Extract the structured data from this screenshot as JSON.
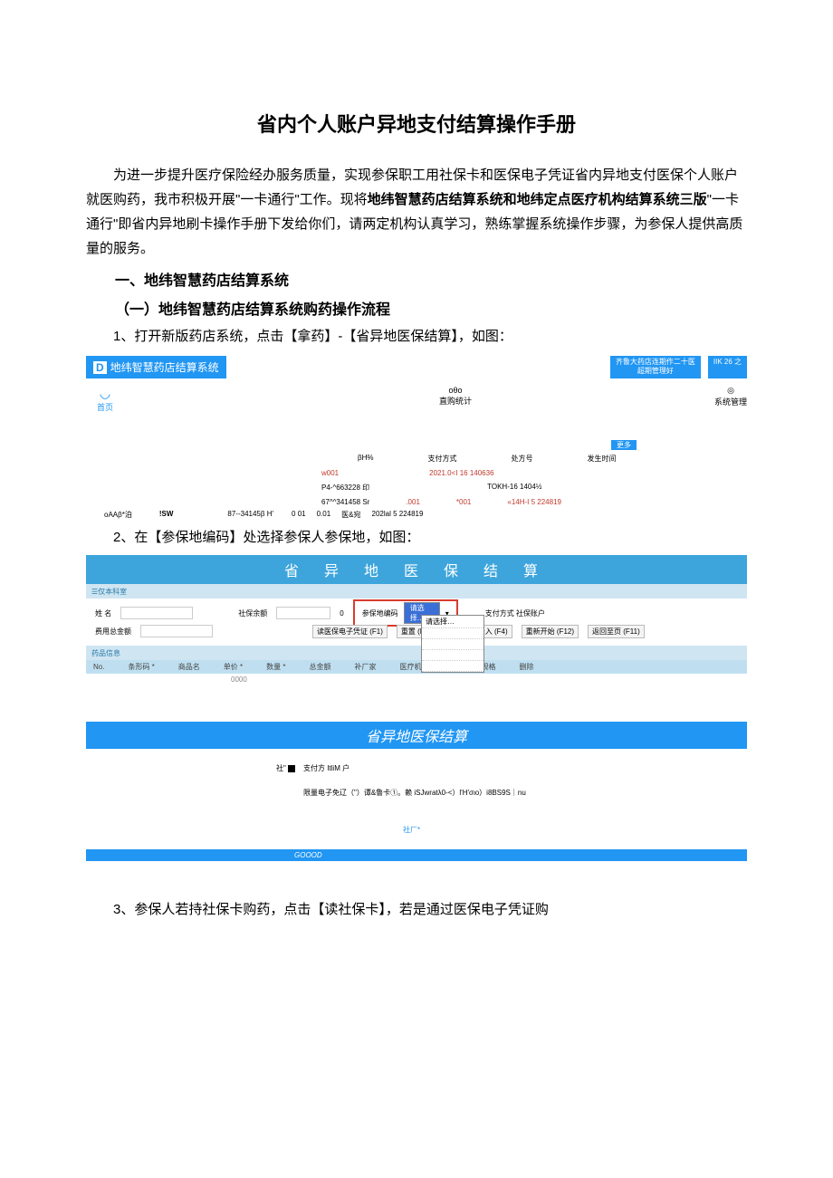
{
  "title": "省内个人账户异地支付结算操作手册",
  "para1_a": "为进一步提升医疗保险经办服务质量，实现参保职工用社保卡和医保电子凭证省内异地支付医保个人账户就医购药，我市积极开展\"一卡通行\"工作。现将",
  "para1_b": "地纬智慧药店结算系统和地纬定点医疗机构结算系统三版",
  "para1_c": "\"一卡通行\"即省内异地刷卡操作手册下发给你们，请两定机构认真学习，熟练掌握系统操作步骤，为参保人提供高质量的服务。",
  "sec1": "一、地纬智慧药店结算系统",
  "sub1": "（一）地纬智慧药店结算系统购药操作流程",
  "step1": "1、打开新版药店系统，点击【拿药】-【省异地医保结算】，如图：",
  "step2": "2、在【参保地编码】处选择参保人参保地，如图：",
  "step3": "3、参保人若持社保卡购药，点击【读社保卡】，若是通过医保电子凭证购",
  "shot1": {
    "banner_d": "D",
    "banner": "地纬智慧药店结算系统",
    "box1a": "齐鲁大药店连期作二十医",
    "box1b": "超期管理好",
    "box2": "IIK 26 之",
    "home": "首页",
    "stat_icon": "oθo",
    "stat": "直购统计",
    "sys_icon": "◎",
    "sys": "系统管理",
    "more": "更多",
    "hdr1": "βH%",
    "hdr2": "支付方式",
    "hdr3": "处方号",
    "hdr4": "发生时间",
    "r1a": "w001",
    "r1b": "2021.0<I 16 140636",
    "r2a": "P4-^663228 印",
    "r2b": "TOKH-16 1404½",
    "r3a": "67^^341458 Sr",
    "r3b": ".001",
    "r3c": "*001",
    "r3d": "«14H-I 5 224819",
    "bot_left1": "oAAβ*泊",
    "bot_left2": "!SW",
    "r4a": "87--34145β H'",
    "r4b": "0 01",
    "r4c": "0.01",
    "r4d": "医&宛",
    "r4e": "202lal 5 224819"
  },
  "shot2": {
    "title": "省 异 地 医 保 结 算",
    "bar": "仅本科室",
    "name_lbl": "姓 名",
    "bal_lbl": "社保余额",
    "bal_val": "0",
    "insloc_lbl": "参保地编码",
    "dropdown_sel": "请选择…",
    "insloc_hint": "请选择…",
    "pay_lbl": "支付方式 社保账户",
    "total_lbl": "费用总金额",
    "btn_read": "读医保电子凭证 (F1)",
    "btn_reset": "重置 (F3)",
    "btn_no": "无病例登录入 (F4)",
    "btn_restart": "重新开始 (F12)",
    "btn_back": "返回至页 (F11)",
    "bar2": "药品信息",
    "col_no": "No.",
    "col_code": "条形码 *",
    "col_name": "商品名",
    "col_price": "单价 *",
    "col_qty": "数量 *",
    "col_amt": "总金额",
    "col_mfr": "补厂家",
    "col_item": "医疗机构项目名称",
    "col_spec": "规格",
    "col_del": "删除",
    "sample": "0000"
  },
  "shot3": {
    "title": "省异地医保结算",
    "line1_a": "社\"",
    "line1_b": "支付方 ItliM 户",
    "line2": "限量电子免辽（\"）谭&鲁卡①。赖 iSJwratλ0-<）l'H'σιο）i8BS9S｜nu",
    "hall": "社厂*",
    "footer": "GOOOD"
  }
}
